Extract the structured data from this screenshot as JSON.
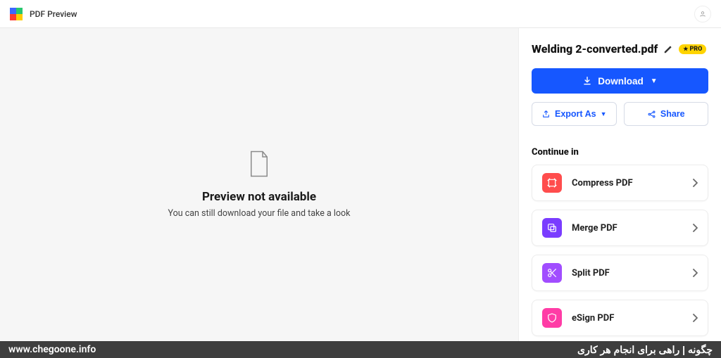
{
  "header": {
    "title": "PDF Preview"
  },
  "preview": {
    "heading": "Preview not available",
    "subtext": "You can still download your file and take a look"
  },
  "side": {
    "filename": "Welding 2-converted.pdf",
    "pro_badge": "PRO",
    "download_label": "Download",
    "export_label": "Export As",
    "share_label": "Share",
    "continue_label": "Continue in",
    "tools": [
      {
        "label": "Compress PDF",
        "icon": "compress"
      },
      {
        "label": "Merge PDF",
        "icon": "merge"
      },
      {
        "label": "Split PDF",
        "icon": "split"
      },
      {
        "label": "eSign PDF",
        "icon": "esign"
      }
    ]
  },
  "footer": {
    "url": "www.chegoone.info",
    "tagline": "چگونه | راهی برای انجام هر کاری"
  }
}
